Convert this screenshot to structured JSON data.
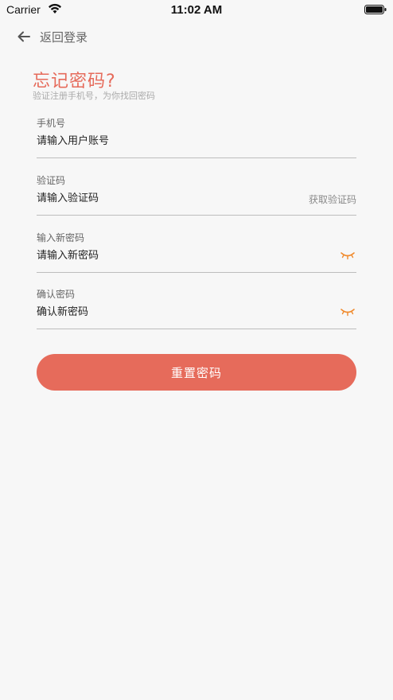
{
  "status_bar": {
    "carrier": "Carrier",
    "time": "11:02 AM"
  },
  "nav": {
    "back_label": "返回登录"
  },
  "header": {
    "title": "忘记密码?",
    "subtitle": "验证注册手机号，为你找回密码"
  },
  "fields": {
    "phone": {
      "label": "手机号",
      "placeholder": "请输入用户账号"
    },
    "code": {
      "label": "验证码",
      "placeholder": "请输入验证码",
      "action_label": "获取验证码"
    },
    "new_password": {
      "label": "输入新密码",
      "placeholder": "请输入新密码"
    },
    "confirm_password": {
      "label": "确认密码",
      "placeholder": "确认新密码"
    }
  },
  "submit": {
    "label": "重置密码"
  },
  "colors": {
    "accent": "#e66b5b",
    "eye_icon": "#f08a2c",
    "background": "#f7f7f7"
  }
}
